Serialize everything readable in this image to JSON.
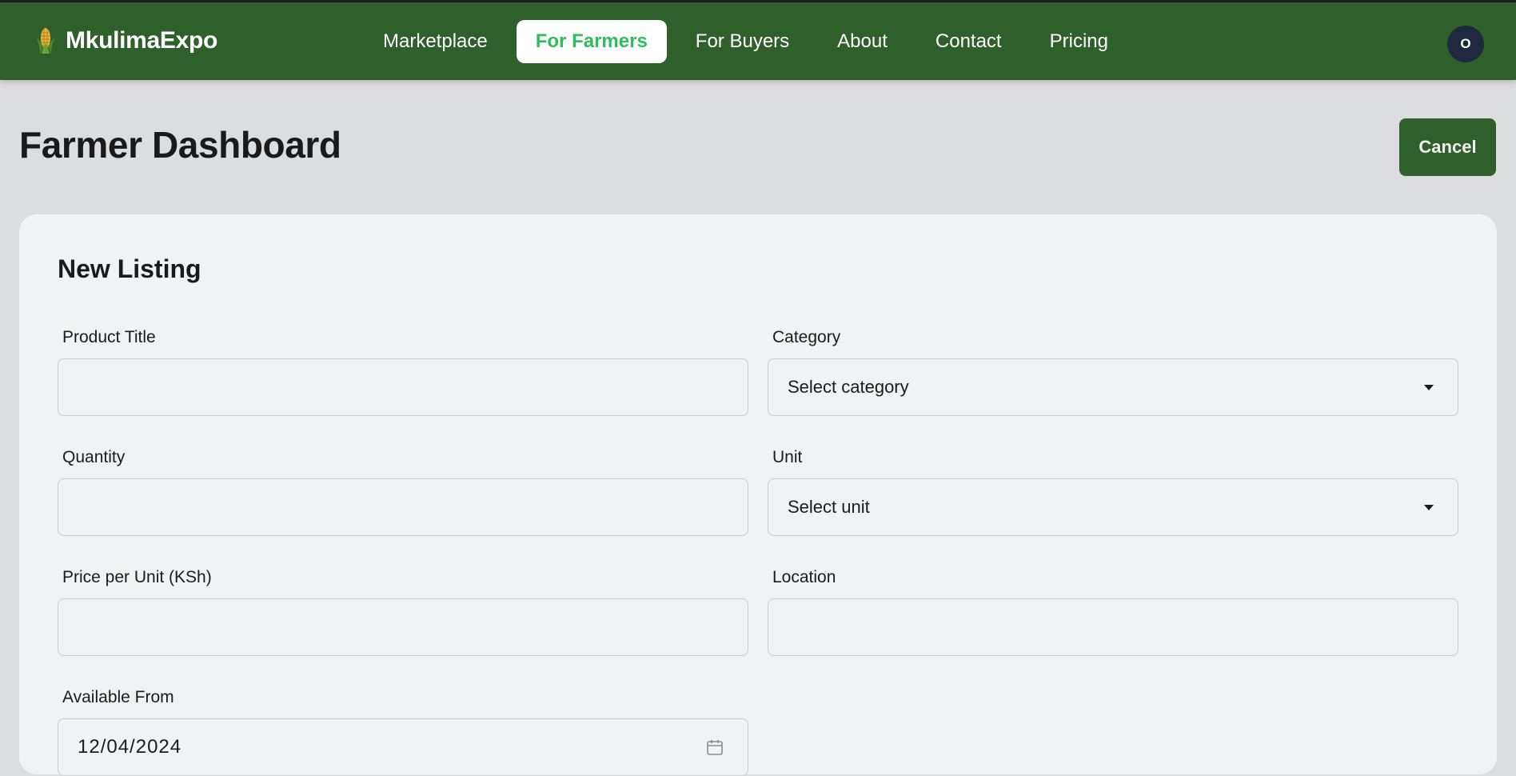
{
  "brand": {
    "name": "MkulimaExpo",
    "icon": "corn-icon"
  },
  "nav": {
    "items": [
      {
        "label": "Marketplace",
        "active": false
      },
      {
        "label": "For Farmers",
        "active": true
      },
      {
        "label": "For Buyers",
        "active": false
      },
      {
        "label": "About",
        "active": false
      },
      {
        "label": "Contact",
        "active": false
      },
      {
        "label": "Pricing",
        "active": false
      }
    ]
  },
  "user": {
    "avatar_initial": "O"
  },
  "header": {
    "title": "Farmer Dashboard",
    "cancel_label": "Cancel"
  },
  "form": {
    "title": "New Listing",
    "product_title": {
      "label": "Product Title",
      "value": ""
    },
    "category": {
      "label": "Category",
      "value": "Select category"
    },
    "quantity": {
      "label": "Quantity",
      "value": ""
    },
    "unit": {
      "label": "Unit",
      "value": "Select unit"
    },
    "price": {
      "label": "Price per Unit (KSh)",
      "value": ""
    },
    "location": {
      "label": "Location",
      "value": ""
    },
    "available_from": {
      "label": "Available From",
      "value": "12/04/2024"
    }
  },
  "colors": {
    "topbar": "#2f5f2a",
    "active_nav_text": "#2fbd5b",
    "page_bg": "#dcdddf",
    "card_bg": "#f1f2f4",
    "avatar_bg": "#1f2a3e"
  }
}
